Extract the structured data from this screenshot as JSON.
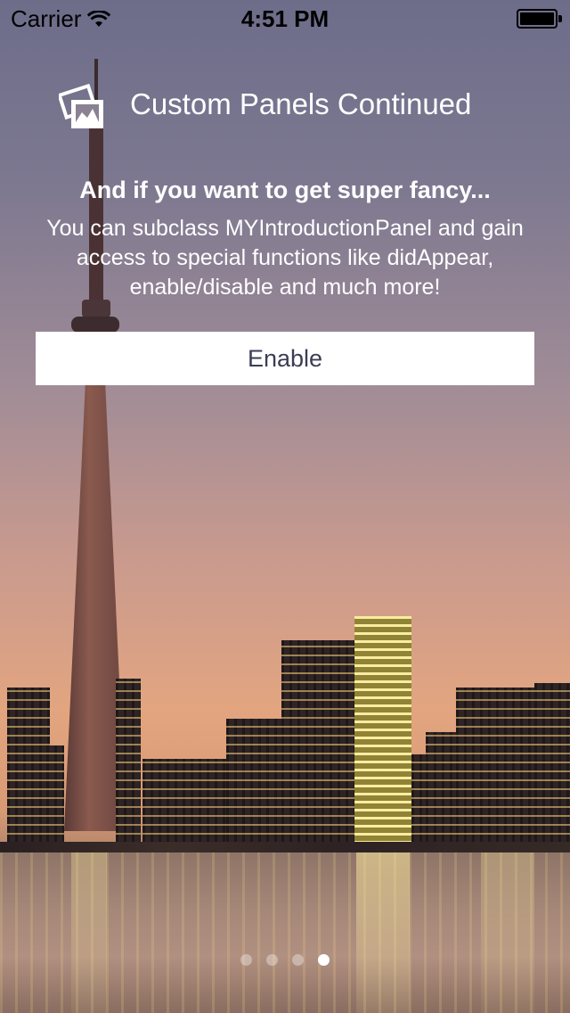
{
  "status_bar": {
    "carrier": "Carrier",
    "time": "4:51 PM",
    "wifi_icon": "wifi-icon",
    "battery_icon": "battery-icon",
    "battery_level": 1.0
  },
  "header": {
    "icon": "photo-icon",
    "title": "Custom Panels Continued"
  },
  "content": {
    "headline": "And if you want to get super fancy...",
    "description": "You can subclass MYIntroductionPanel and gain access to special functions like didAppear, enable/disable and much more!",
    "button_label": "Enable"
  },
  "page_control": {
    "page_count": 4,
    "current_page": 4
  },
  "colors": {
    "button_text": "#3a3e55",
    "text": "#ffffff",
    "dot_active": "#ffffff",
    "dot_inactive": "rgba(255,255,255,0.35)"
  }
}
